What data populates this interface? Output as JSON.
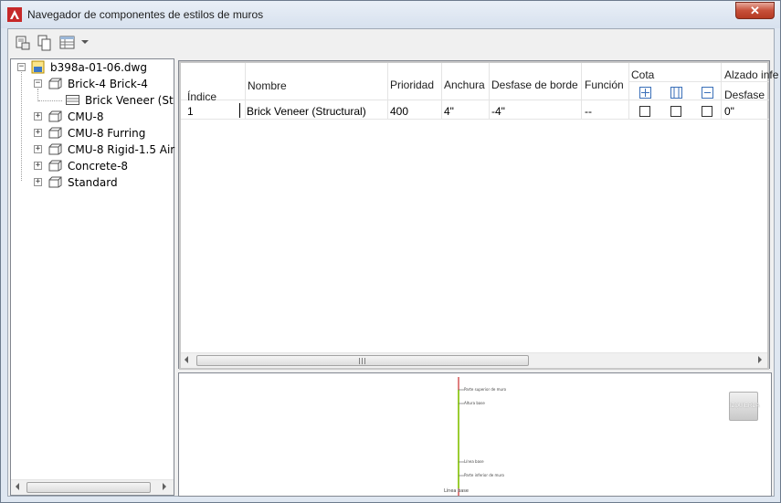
{
  "window": {
    "title": "Navegador de componentes de estilos de muros",
    "close_glyph": "✕"
  },
  "toolbar": {
    "icons": [
      "new-component-icon",
      "copy-component-icon",
      "table-view-icon",
      "dropdown-arrow-icon"
    ]
  },
  "tree": {
    "root": "b398a-01-06.dwg",
    "items": [
      {
        "label": "Brick-4 Brick-4",
        "expanded": true,
        "children": [
          "Brick Veneer (Structural)"
        ]
      },
      {
        "label": "CMU-8",
        "expanded": false
      },
      {
        "label": "CMU-8 Furring",
        "expanded": false
      },
      {
        "label": "CMU-8 Rigid-1.5 Air",
        "expanded": false
      },
      {
        "label": "Concrete-8",
        "expanded": false
      },
      {
        "label": "Standard",
        "expanded": false
      }
    ]
  },
  "grid": {
    "headers": {
      "indice": "Índice",
      "nombre": "Nombre",
      "prioridad": "Prioridad",
      "anchura": "Anchura",
      "desfase_borde": "Desfase de borde",
      "funcion": "Función",
      "cota": "Cota",
      "alzado": "Alzado infe",
      "desfase": "Desfase"
    },
    "rows": [
      {
        "indice": "1",
        "nombre": "Brick Veneer (Structural)",
        "prioridad": "400",
        "anchura": "4\"",
        "desfase_borde": "-4\"",
        "funcion": "--",
        "checks": [
          false,
          false,
          false
        ],
        "desfase": "0\""
      }
    ]
  },
  "preview": {
    "view_label": "IZQUIERDA",
    "labels": [
      "Parte superior de muro",
      "Altura base",
      "Línea base",
      "Parte inferior de muro"
    ],
    "bottom_label": "Línea base"
  },
  "colors": {
    "accent_red": "#c0392b",
    "wall_green": "#9acd32",
    "wall_red": "#c00000"
  }
}
